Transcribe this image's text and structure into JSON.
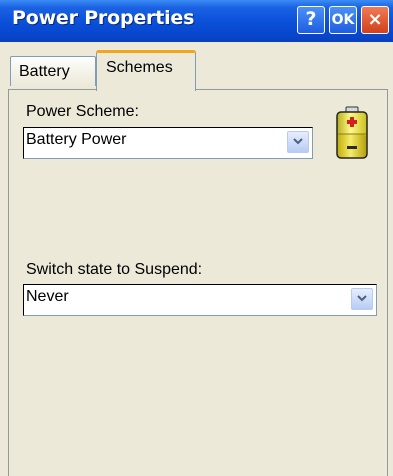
{
  "window": {
    "title": "Power Properties",
    "help_label": "?",
    "ok_label": "OK",
    "close_label": "×"
  },
  "tabs": [
    {
      "label": "Battery",
      "active": false
    },
    {
      "label": "Schemes",
      "active": true
    }
  ],
  "power_scheme": {
    "label": "Power Scheme:",
    "value": "Battery Power",
    "icon": "battery-icon"
  },
  "suspend": {
    "label": "Switch state to Suspend:",
    "value": "Never"
  },
  "colors": {
    "title_bar": "#0A4FD9",
    "window_bg": "#ECE9D8",
    "close_button": "#D2401C",
    "active_tab_highlight": "#F3A61C",
    "battery_top": "#E8E033",
    "battery_plus": "#D42020"
  }
}
